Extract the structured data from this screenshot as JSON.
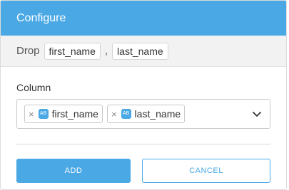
{
  "header": {
    "title": "Configure"
  },
  "summary": {
    "prefix": "Drop",
    "tokens": [
      "first_name",
      "last_name"
    ],
    "separator": ","
  },
  "field": {
    "label": "Column",
    "selected": [
      {
        "name": "first_name",
        "type_badge": "AB"
      },
      {
        "name": "last_name",
        "type_badge": "AB"
      }
    ],
    "remove_glyph": "×",
    "caret_icon": "chevron-down-icon"
  },
  "actions": {
    "add_label": "ADD",
    "cancel_label": "CANCEL"
  },
  "colors": {
    "accent": "#4aa8e5",
    "summary_bg": "#f2f2f2"
  }
}
